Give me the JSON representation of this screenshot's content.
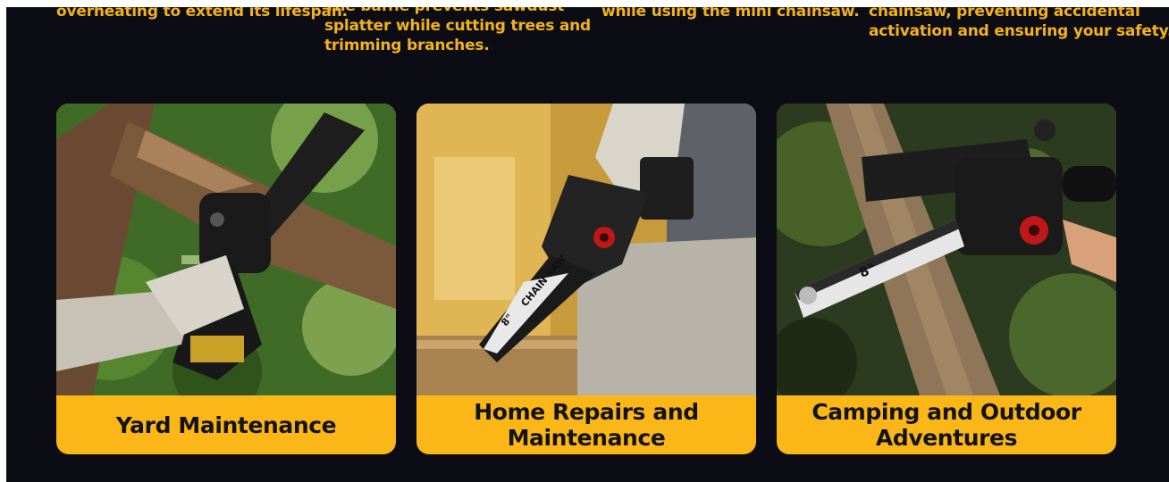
{
  "features": [
    {
      "lines": [
        "overheating to extend its lifespan."
      ]
    },
    {
      "lines": [
        "The baffle prevents sawdust",
        "splatter while cutting trees and",
        "trimming branches."
      ]
    },
    {
      "lines": [
        "while using the mini chainsaw."
      ]
    },
    {
      "lines": [
        "chainsaw, preventing accidental",
        "activation and ensuring your safety."
      ]
    }
  ],
  "cards": [
    {
      "label": "Yard Maintenance",
      "icon": "yard-photo"
    },
    {
      "label": "Home Repairs and Maintenance",
      "icon": "home-repair-photo"
    },
    {
      "label": "Camping and Outdoor Adventures",
      "icon": "camping-photo"
    }
  ],
  "saw_marks": {
    "size": "8\"",
    "brand": "CHAIN SAW"
  },
  "colors": {
    "background": "#0c0d14",
    "accent": "#fbb617",
    "text_accent": "#f4b21a"
  }
}
